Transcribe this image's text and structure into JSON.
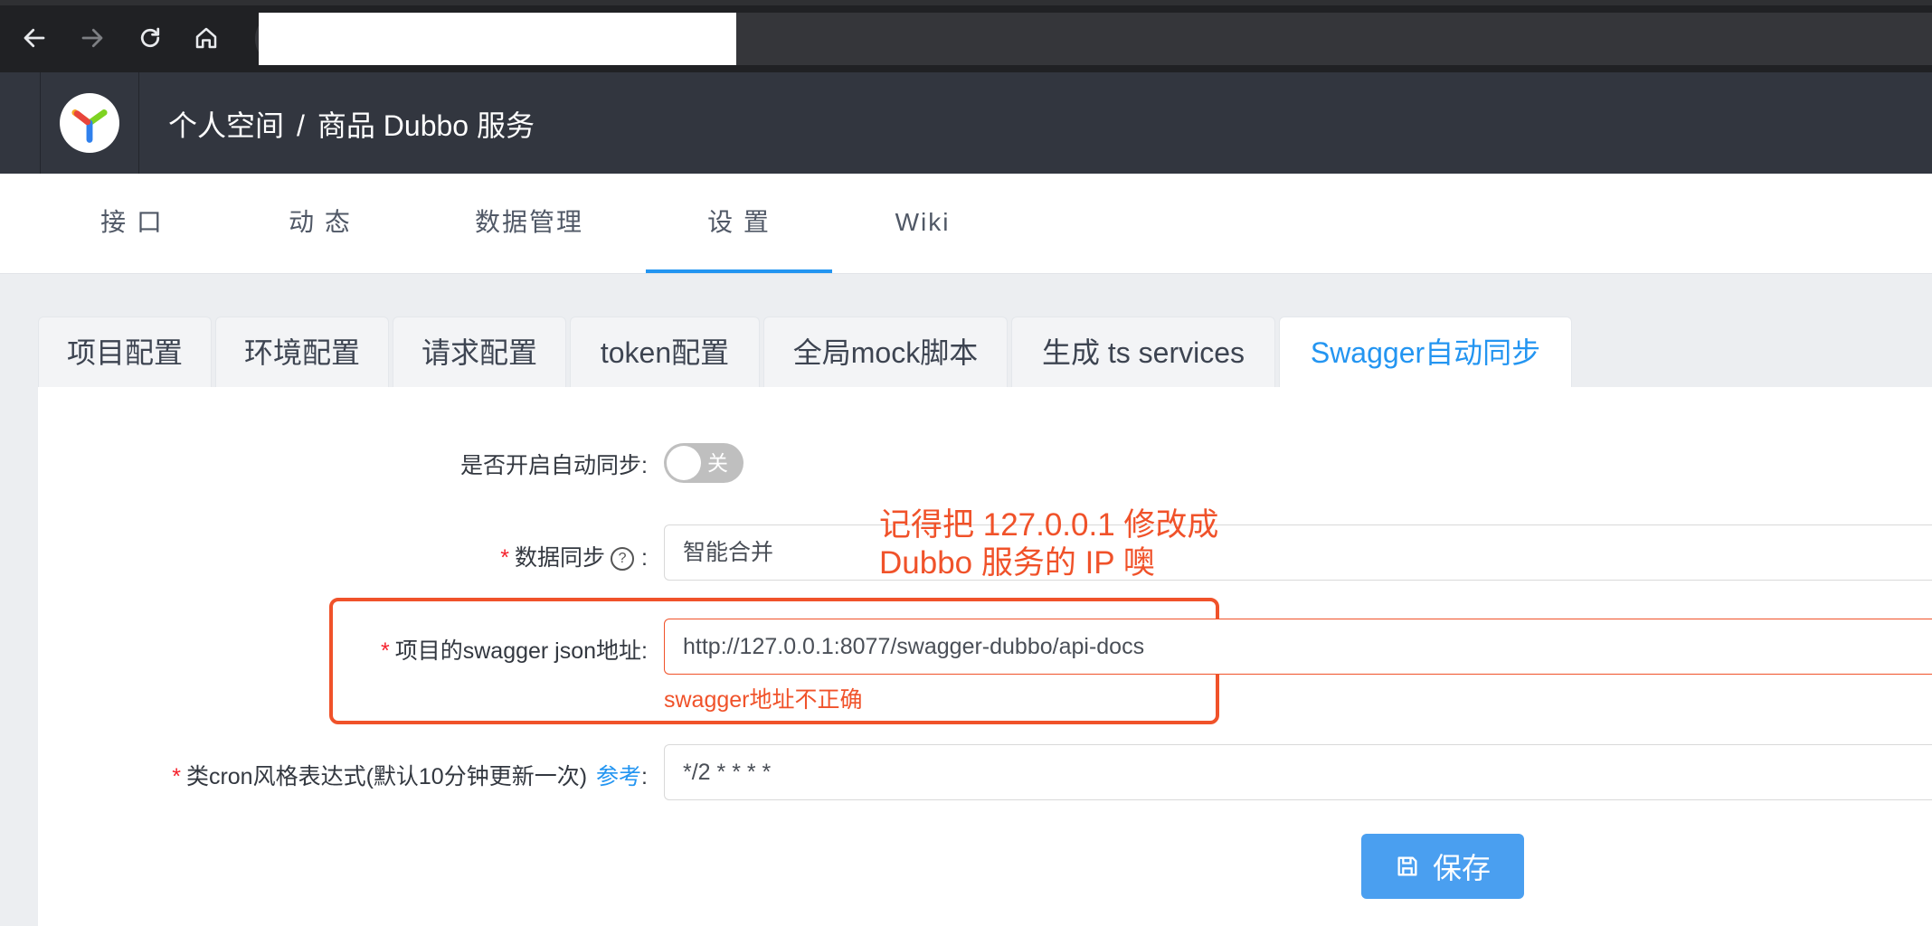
{
  "browser": {
    "back_icon": "arrow-left-icon",
    "forward_icon": "arrow-right-icon",
    "reload_icon": "reload-icon",
    "home_icon": "home-icon"
  },
  "header": {
    "breadcrumb_root": "个人空间",
    "breadcrumb_sep": "/",
    "breadcrumb_project": "商品 Dubbo 服务"
  },
  "subnav": {
    "tabs": [
      "接 口",
      "动 态",
      "数据管理",
      "设 置",
      "Wiki"
    ],
    "active": "设 置"
  },
  "settings_tabs": {
    "tabs": [
      "项目配置",
      "环境配置",
      "请求配置",
      "token配置",
      "全局mock脚本",
      "生成 ts services",
      "Swagger自动同步"
    ],
    "active": "Swagger自动同步"
  },
  "form": {
    "auto_sync_label": "是否开启自动同步",
    "auto_sync_switch_text": "关",
    "data_sync_label": "数据同步",
    "data_sync_value": "智能合并",
    "swagger_url_label": "项目的swagger json地址",
    "swagger_url_value": "http://127.0.0.1:8077/swagger-dubbo/api-docs",
    "swagger_url_error": "swagger地址不正确",
    "cron_label": "类cron风格表达式(默认10分钟更新一次)",
    "cron_ref_link": "参考",
    "cron_value": "*/2 * * * *",
    "colon": ":",
    "save_label": "保存"
  },
  "annotation": {
    "line1": "记得把 127.0.0.1 修改成",
    "line2": "Dubbo 服务的 IP 噢"
  },
  "colors": {
    "accent": "#2395f1",
    "error": "#f0522a",
    "header_bg": "#32363f"
  }
}
